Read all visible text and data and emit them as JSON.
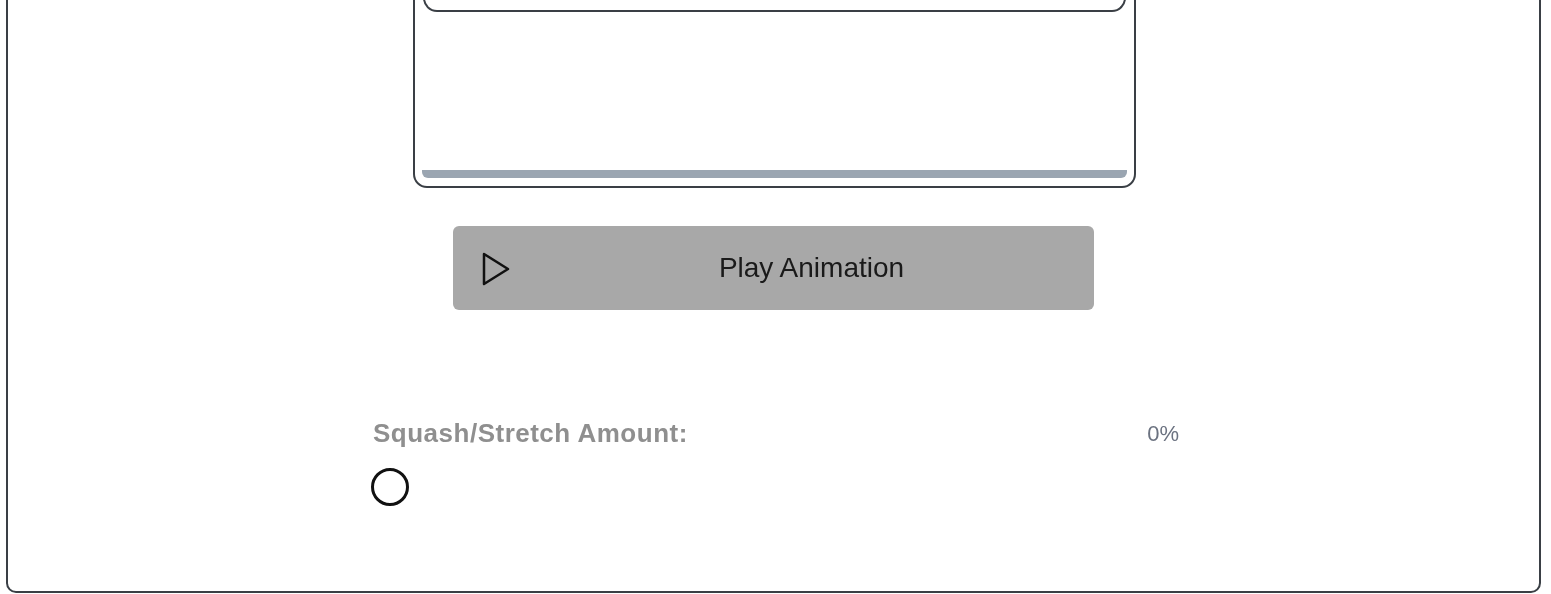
{
  "play_button": {
    "label": "Play Animation"
  },
  "squash_stretch": {
    "label": "Squash/Stretch Amount:",
    "reading": "0%",
    "level": 0
  }
}
